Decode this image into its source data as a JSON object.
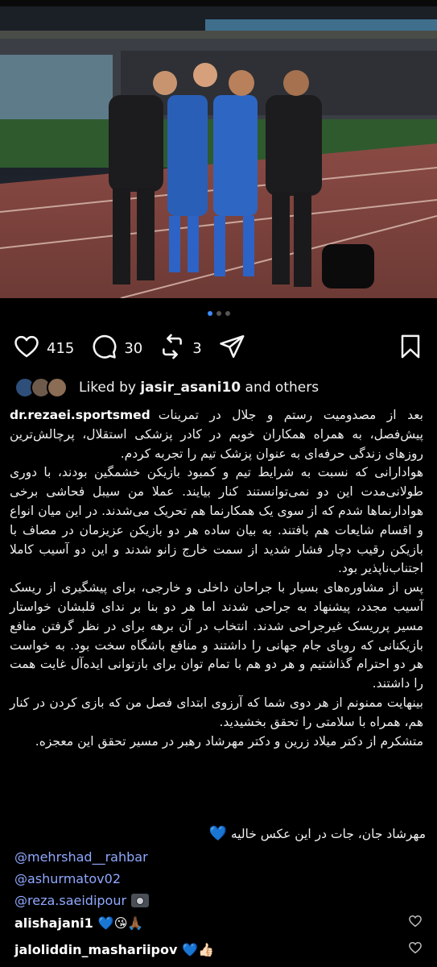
{
  "post": {
    "likes_count": "415",
    "comments_count": "30",
    "reposts_count": "3",
    "liked_by_prefix": "Liked by",
    "liked_by_user": "jasir_asani10",
    "liked_by_suffix": "and others",
    "author": "dr.rezaei.sportsmed",
    "caption_paragraphs": [
      "بعد از مصدومیت رستم و جلال در تمرینات پیش‌فصل، به همراه همکاران خوبم در کادر پزشکی استقلال، پرچالش‌ترین روزهای زندگی حرفه‌ای به عنوان پزشک تیم را تجربه کردم.",
      "هوادارانی که نسبت به شرایط تیم و کمبود بازیکن خشمگین بودند، با دوری طولانی‌مدت این دو نمی‌توانستند کنار بیایند. عملا من سیبل فحاشی برخی هوادارنماها شدم که از سوی یک همکارنما هم تحریک می‌شدند. در این میان انواع و اقسام شایعات هم بافتند. به بیان ساده هر دو بازیکن عزیزمان در مصاف با بازیکن رقیب دچار فشار شدید از سمت خارج زانو شدند و این دو آسیب کاملا اجتناب‌ناپذیر بود.",
      "پس از مشاوره‌های بسیار با جراحان داخلی و خارجی، برای پیشگیری از ریسک آسیب مجدد، پیشنهاد به جراحی شدند اما هر دو بنا بر ندای قلبشان خواستار مسیر پرریسک غیرجراحی شدند. انتخاب در آن برهه برای در نظر گرفتن منافع بازیکنانی که رویای جام جهانی را داشتند و منافع باشگاه سخت بود. به خواست هر دو احترام گذاشتیم و هر دو هم با تمام توان برای بازتوانی ایده‌آل غایت همت را داشتند.",
      "بینهایت ممنونم از هر دوی شما که آرزوی ابتدای فصل من که بازی کردن در کنار هم، همراه با سلامتی را تحقق بخشیدید.",
      "متشکرم از دکتر میلاد زرین و دکتر مهرشاد رهبر در مسیر تحقق این معجزه."
    ],
    "closing_line": "مهرشاد جان، جات در این عکس خالیه",
    "closing_emoji": "💙",
    "mentions": [
      "@mehrshad__rahbar",
      "@ashurmatov02",
      "@reza.saeidipour"
    ]
  },
  "comments": [
    {
      "user": "alishajani1",
      "emoji": "💙😘🙏🏾"
    },
    {
      "user": "jaloliddin_mashariipov",
      "emoji": "💙👍🏻"
    }
  ],
  "carousel": {
    "total": 3,
    "active": 1
  },
  "colors": {
    "accent_blue": "#3b8cff",
    "mention": "#8fa8ff"
  },
  "icons": [
    "heart-icon",
    "comment-icon",
    "repost-icon",
    "share-icon",
    "bookmark-icon",
    "camera-icon"
  ]
}
